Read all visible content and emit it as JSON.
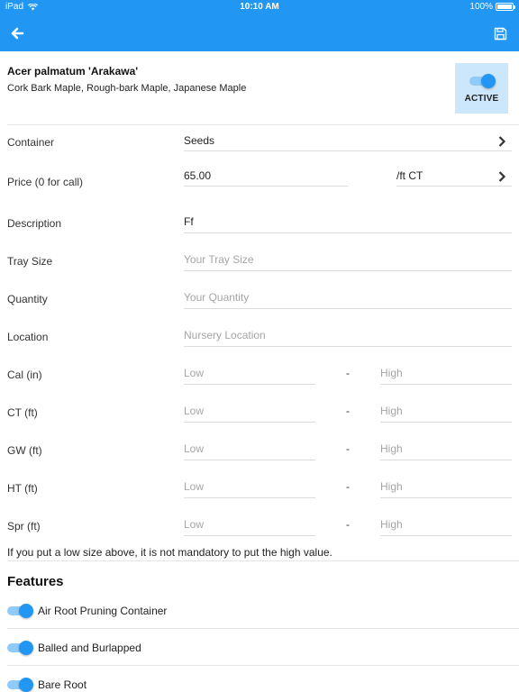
{
  "status_bar": {
    "device": "iPad",
    "time": "10:10 AM",
    "battery": "100%"
  },
  "plant": {
    "name": "Acer palmatum 'Arakawa'",
    "common_names": "Cork Bark Maple, Rough-bark Maple, Japanese Maple",
    "active_label": "ACTIVE",
    "active": true
  },
  "form": {
    "container": {
      "label": "Container",
      "value": "Seeds"
    },
    "price": {
      "label": "Price (0 for call)",
      "value": "65.00",
      "unit": "/ft CT"
    },
    "description": {
      "label": "Description",
      "value": "Ff"
    },
    "tray_size": {
      "label": "Tray Size",
      "placeholder": "Your Tray Size"
    },
    "quantity": {
      "label": "Quantity",
      "placeholder": "Your Quantity"
    },
    "location": {
      "label": "Location",
      "placeholder": "Nursery Location"
    },
    "size_ranges": [
      {
        "label": "Cal (in)",
        "low": "Low",
        "high": "High"
      },
      {
        "label": "CT (ft)",
        "low": "Low",
        "high": "High"
      },
      {
        "label": "GW (ft)",
        "low": "Low",
        "high": "High"
      },
      {
        "label": "HT (ft)",
        "low": "Low",
        "high": "High"
      },
      {
        "label": "Spr (ft)",
        "low": "Low",
        "high": "High"
      }
    ],
    "range_separator": "-",
    "note": "If you put a low size above, it is not mandatory to put the high value."
  },
  "features": {
    "title": "Features",
    "items": [
      {
        "label": "Air Root Pruning Container",
        "on": true
      },
      {
        "label": "Balled and Burlapped",
        "on": true
      },
      {
        "label": "Bare Root",
        "on": true
      }
    ]
  },
  "colors": {
    "primary": "#2196f3",
    "toggle_track": "#90caf9",
    "active_bg": "#cce6fb"
  }
}
